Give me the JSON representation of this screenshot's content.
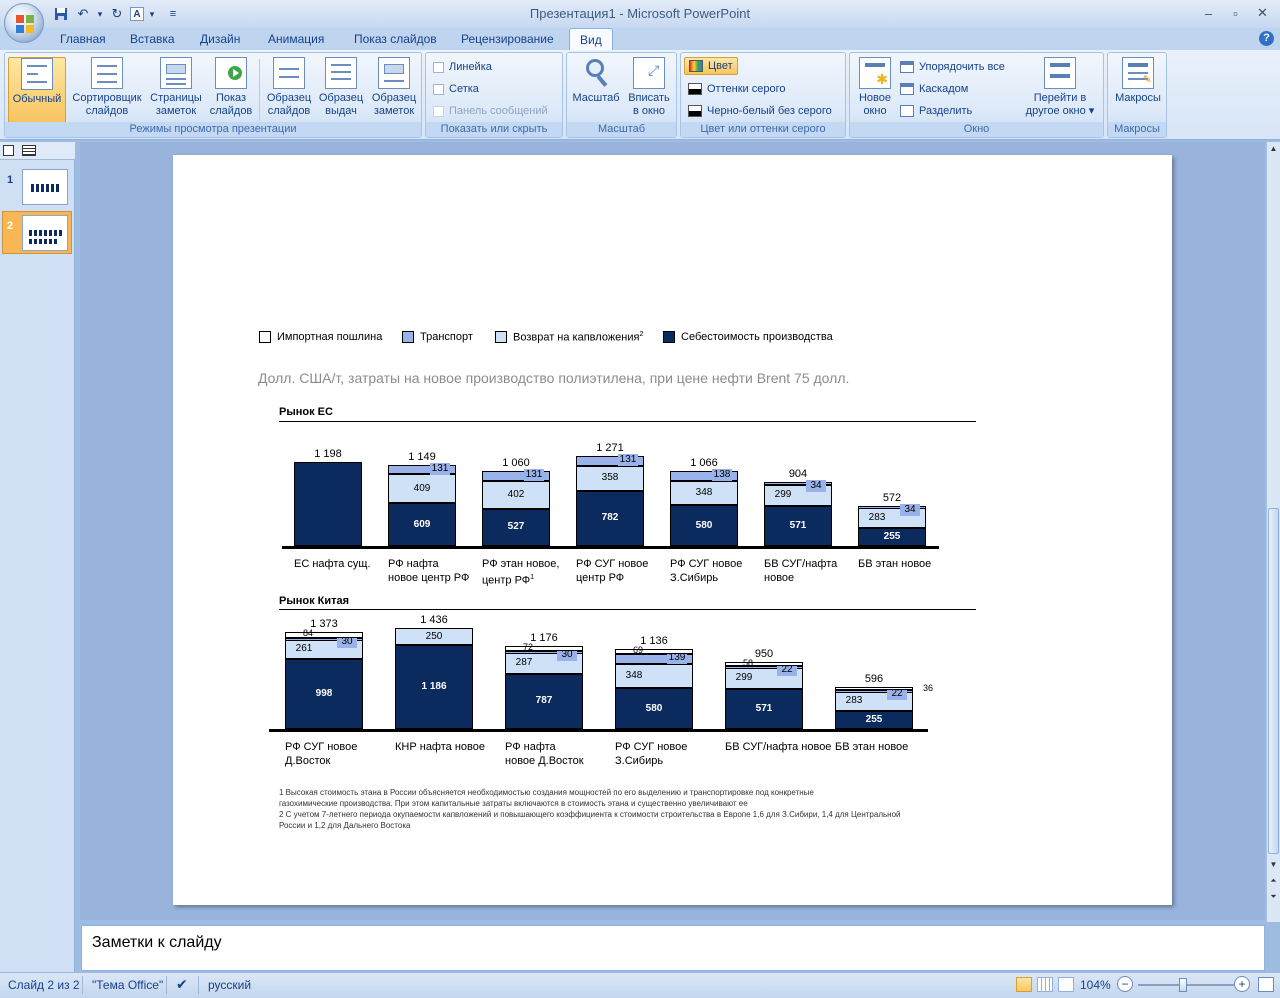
{
  "window": {
    "title": "Презентация1 - Microsoft PowerPoint",
    "minimize": "–",
    "maximize": "▫",
    "close": "✕"
  },
  "quick_access": {
    "save": "💾",
    "undo": "↶",
    "undo_dd": "▾",
    "redo": "↻",
    "font": "A",
    "font_dd": "▾",
    "customize": "≡"
  },
  "tabs": [
    "Главная",
    "Вставка",
    "Дизайн",
    "Анимация",
    "Показ слайдов",
    "Рецензирование",
    "Вид"
  ],
  "active_tab": "Вид",
  "ribbon": {
    "views_group": {
      "label": "Режимы просмотра презентации",
      "normal": [
        "Обычный",
        ""
      ],
      "sorter": [
        "Сортировщик",
        "слайдов"
      ],
      "notes_page": [
        "Страницы",
        "заметок"
      ],
      "slideshow": [
        "Показ",
        "слайдов"
      ],
      "slide_master": [
        "Образец",
        "слайдов"
      ],
      "handout_master": [
        "Образец",
        "выдач"
      ],
      "notes_master": [
        "Образец",
        "заметок"
      ]
    },
    "show_group": {
      "label": "Показать или скрыть",
      "ruler": "Линейка",
      "grid": "Сетка",
      "message_bar": "Панель сообщений"
    },
    "zoom_group": {
      "label": "Масштаб",
      "zoom": [
        "Масштаб",
        ""
      ],
      "fit": [
        "Вписать",
        "в окно"
      ]
    },
    "color_group": {
      "label": "Цвет или оттенки серого",
      "color": "Цвет",
      "grayscale": "Оттенки серого",
      "bw": "Черно-белый без серого"
    },
    "window_group": {
      "label": "Окно",
      "new_window": [
        "Новое",
        "окно"
      ],
      "arrange_all": "Упорядочить все",
      "cascade": "Каскадом",
      "split": "Разделить",
      "switch": [
        "Перейти в",
        "другое окно ▾"
      ]
    },
    "macros_group": {
      "label": "Макросы",
      "macros": "Макросы"
    }
  },
  "slides_panel": {
    "numbers": [
      "1",
      "2"
    ]
  },
  "notes": {
    "placeholder": "Заметки к слайду"
  },
  "status": {
    "slide": "Слайд 2 из 2",
    "theme": "\"Тема Office\"",
    "language": "русский",
    "zoom": "104%",
    "zoom_out": "−",
    "zoom_in": "+"
  },
  "colors": {
    "import_duty": "#ffffff",
    "transport": "#99b3ea",
    "capex_return": "#cfe1f7",
    "cost": "#0b2a5e"
  },
  "chart_data": [
    {
      "type": "bar",
      "stacked": true,
      "title": "Рынок ЕС",
      "subtitle": "Долл. США/т, затраты на новое производство полиэтилена, при цене нефти Brent 75 долл.",
      "legend": [
        {
          "name": "Импортная пошлина",
          "color_key": "import_duty"
        },
        {
          "name": "Транспорт",
          "color_key": "transport"
        },
        {
          "name": "Возврат на капвложения",
          "sup": "2",
          "color_key": "capex_return"
        },
        {
          "name": "Себестоимость производства",
          "color_key": "cost"
        }
      ],
      "categories": [
        [
          "ЕС нафта сущ.",
          ""
        ],
        [
          "РФ нафта",
          "новое центр РФ"
        ],
        [
          "РФ этан новое,",
          "центр РФ"
        ],
        [
          "РФ СУГ новое",
          "центр РФ"
        ],
        [
          "РФ СУГ новое",
          "З.Сибирь"
        ],
        [
          "БВ СУГ/нафта",
          "новое"
        ],
        [
          "БВ этан новое",
          ""
        ]
      ],
      "category_sup": [
        "",
        "",
        "1",
        "",
        "",
        "",
        ""
      ],
      "totals": [
        "1 198",
        "1 149",
        "1 060",
        "1 271",
        "1 066",
        "904",
        "572"
      ],
      "series": [
        {
          "name": "Себестоимость производства",
          "values": [
            1198,
            609,
            527,
            782,
            580,
            571,
            255
          ]
        },
        {
          "name": "Возврат на капвложения",
          "values": [
            0,
            409,
            402,
            358,
            348,
            299,
            283
          ]
        },
        {
          "name": "Транспорт",
          "values": [
            0,
            131,
            131,
            131,
            138,
            34,
            34
          ]
        }
      ],
      "segment_labels": [
        [
          "",
          "",
          ""
        ],
        [
          "609",
          "409",
          "131"
        ],
        [
          "527",
          "402",
          "131"
        ],
        [
          "782",
          "358",
          "131"
        ],
        [
          "580",
          "348",
          "138"
        ],
        [
          "571",
          "299",
          "34"
        ],
        [
          "255",
          "283",
          "34"
        ]
      ]
    },
    {
      "type": "bar",
      "stacked": true,
      "title": "Рынок Китая",
      "categories": [
        [
          "РФ СУГ новое",
          "Д.Восток"
        ],
        [
          "КНР нафта новое",
          ""
        ],
        [
          "РФ нафта",
          "новое Д.Восток"
        ],
        [
          "РФ СУГ новое",
          "З.Сибирь"
        ],
        [
          "БВ СУГ/нафта новое",
          ""
        ],
        [
          "БВ этан новое",
          ""
        ]
      ],
      "totals": [
        "1 373",
        "1 436",
        "1 176",
        "1 136",
        "950",
        "596"
      ],
      "series": [
        {
          "name": "Себестоимость производства",
          "values": [
            998,
            1186,
            787,
            580,
            571,
            255
          ]
        },
        {
          "name": "Возврат на капвложения",
          "values": [
            261,
            250,
            287,
            348,
            299,
            283
          ]
        },
        {
          "name": "Транспорт",
          "values": [
            30,
            0,
            30,
            139,
            22,
            22
          ]
        },
        {
          "name": "Импортная пошлина",
          "values": [
            84,
            0,
            72,
            69,
            58,
            36
          ]
        }
      ],
      "segment_labels": [
        [
          "998",
          "261",
          "30",
          "84"
        ],
        [
          "1 186",
          "250",
          "",
          ""
        ],
        [
          "787",
          "287",
          "30",
          "72"
        ],
        [
          "580",
          "348",
          "139",
          "69"
        ],
        [
          "571",
          "299",
          "22",
          "58"
        ],
        [
          "255",
          "283",
          "22",
          "36"
        ]
      ]
    }
  ],
  "footnotes": [
    "1 Высокая стоимость этана в России объясняется необходимостью создания мощностей по его выделению и транспортировке под конкретные",
    "газохимические производства. При этом капитальные затраты включаются в  стоимость этана и существенно увеличивают ее",
    "2 С учетом 7-летнего периода окупаемости капвложений и повышающего коэффициента к стоимости строительства в Европе 1,6 для З.Сибири, 1,4 для Центральной",
    "России и 1,2 для Дальнего Востока"
  ]
}
